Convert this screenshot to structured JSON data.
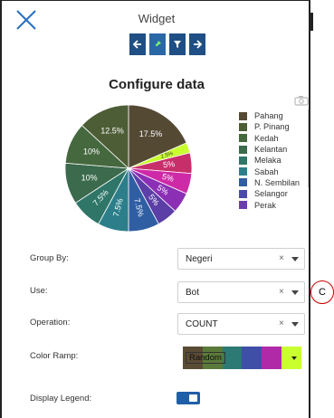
{
  "header": {
    "title": "Widget"
  },
  "toolbar": {
    "buttons": [
      {
        "icon": "arrow-left-icon"
      },
      {
        "icon": "pin-icon",
        "active": true
      },
      {
        "icon": "filter-icon"
      },
      {
        "icon": "arrow-right-icon"
      }
    ]
  },
  "main": {
    "heading": "Configure data"
  },
  "chart_data": {
    "type": "pie",
    "title": "",
    "slices": [
      {
        "label": "Pahang",
        "value": 17.5,
        "display": "17.5%",
        "color": "#544a34"
      },
      {
        "label": "",
        "value": 2.5,
        "display": "2.5%",
        "color": "#c9ff2e"
      },
      {
        "label": "",
        "value": 5,
        "display": "5%",
        "color": "#c82f6a"
      },
      {
        "label": "",
        "value": 5,
        "display": "5%",
        "color": "#ce2aa8"
      },
      {
        "label": "",
        "value": 5,
        "display": "5%",
        "color": "#8b2fb5"
      },
      {
        "label": "",
        "value": 5,
        "display": "5%",
        "color": "#5b3ea6"
      },
      {
        "label": "",
        "value": 7.5,
        "display": "7.5%",
        "color": "#2f5ea3"
      },
      {
        "label": "",
        "value": 7.5,
        "display": "7.5%",
        "color": "#2c7f8a"
      },
      {
        "label": "",
        "value": 7.5,
        "display": "7.5%",
        "color": "#2f7668"
      },
      {
        "label": "",
        "value": 10,
        "display": "10%",
        "color": "#3b6a4c"
      },
      {
        "label": "",
        "value": 10,
        "display": "10%",
        "color": "#45683e"
      },
      {
        "label": "",
        "value": 12.5,
        "display": "12.5%",
        "color": "#4d5d36"
      }
    ],
    "legend": [
      {
        "label": "Pahang",
        "color": "#544a34"
      },
      {
        "label": "P. Pinang",
        "color": "#4d5d36"
      },
      {
        "label": "Kedah",
        "color": "#45683e"
      },
      {
        "label": "Kelantan",
        "color": "#3b6a4c"
      },
      {
        "label": "Melaka",
        "color": "#2f7668"
      },
      {
        "label": "Sabah",
        "color": "#2c7f8a"
      },
      {
        "label": "N. Sembilan",
        "color": "#2f5ea3"
      },
      {
        "label": "Selangor",
        "color": "#4a4aa8"
      },
      {
        "label": "Perak",
        "color": "#6a3db0"
      }
    ],
    "legend_placement": "right"
  },
  "form": {
    "group_by": {
      "label": "Group By:",
      "value": "Negeri",
      "clear": "×"
    },
    "use": {
      "label": "Use:",
      "value": "Bot",
      "clear": "×"
    },
    "operation": {
      "label": "Operation:",
      "value": "COUNT",
      "clear": "×"
    },
    "color_ramp": {
      "label": "Color Ramp:",
      "value": "Random",
      "colors": [
        "#5a4b34",
        "#5a7a3a",
        "#2d7a74",
        "#3f4fa8",
        "#b02aa8",
        "#c9ff2e"
      ]
    },
    "display_legend": {
      "label": "Display Legend:",
      "checked": true
    }
  },
  "annotation": {
    "callout": "C",
    "color": "#cc0000"
  }
}
